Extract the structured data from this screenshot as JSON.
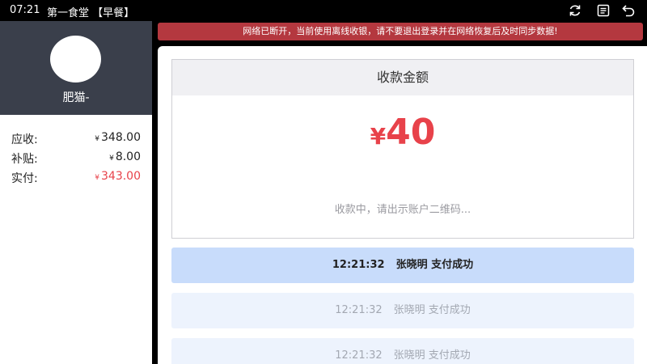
{
  "statusbar": {
    "time": "07:21",
    "title": "第一食堂 【早餐】"
  },
  "icons": {
    "refresh": "refresh-icon",
    "receipt": "receipt-icon",
    "back": "back-icon"
  },
  "user": {
    "name": "肥猫-"
  },
  "summary": [
    {
      "label": "应收:",
      "currency": "¥",
      "amount": "348.00"
    },
    {
      "label": "补贴:",
      "currency": "¥",
      "amount": "8.00"
    },
    {
      "label": "实付:",
      "currency": "¥",
      "amount": "343.00"
    }
  ],
  "banner": {
    "text": "网络已断开，当前使用离线收银，请不要退出登录并在网络恢复后及时同步数据!"
  },
  "collect": {
    "header": "收款金额",
    "currency": "¥",
    "amount": "40",
    "hint": "收款中，请出示账户二维码..."
  },
  "records": [
    {
      "time": "12:21:32",
      "text": "张晓明 支付成功"
    },
    {
      "time": "12:21:32",
      "text": "张晓明 支付成功"
    },
    {
      "time": "12:21:32",
      "text": "张晓明 支付成功"
    }
  ],
  "colors": {
    "accent_red": "#e8424a",
    "banner": "#b4383f",
    "profile_bg": "#3a3f4b",
    "active_row": "#c8dcfb"
  }
}
